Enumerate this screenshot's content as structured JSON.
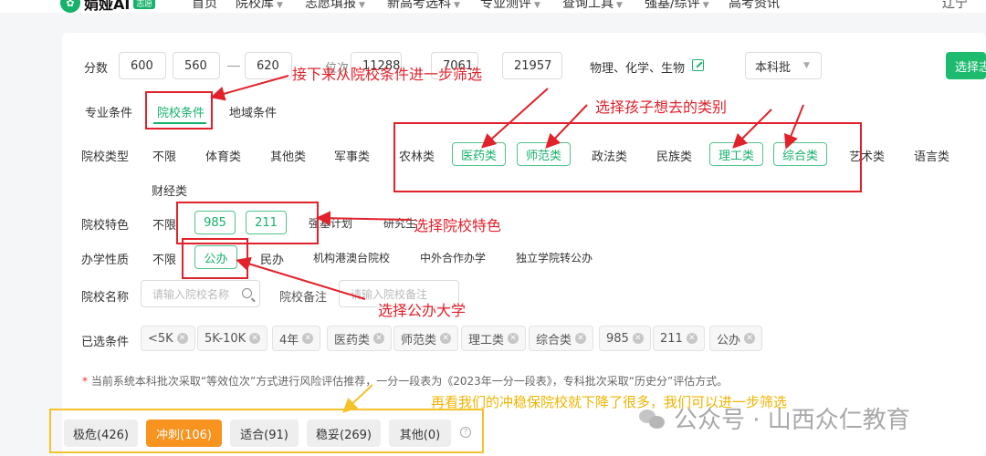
{
  "nav": {
    "logo_text": "娟娅AI",
    "logo_badge": "志愿",
    "items": [
      "首页",
      "院校库",
      "志愿填报",
      "新高考选科",
      "专业测评",
      "查询工具",
      "强基/综评",
      "高考资讯"
    ],
    "user": "辽宁"
  },
  "score_row": {
    "label": "分数",
    "score1": "600",
    "score2": "560",
    "score3": "620",
    "rank_label": "位次",
    "rank1": "11288",
    "rank2": "7061",
    "rank3": "21957",
    "subjects": "物理、化学、生物",
    "batch": "本科批",
    "submit": "选择志"
  },
  "tabs": [
    "专业条件",
    "院校条件",
    "地域条件"
  ],
  "school_type": {
    "label": "院校类型",
    "options": [
      "不限",
      "体育类",
      "其他类",
      "军事类",
      "农林类",
      "医药类",
      "师范类",
      "政法类",
      "民族类",
      "理工类",
      "综合类",
      "艺术类",
      "语言类",
      "财经类"
    ]
  },
  "school_feature": {
    "label": "院校特色",
    "options": [
      "不限",
      "985",
      "211",
      "强基计划",
      "研究生"
    ]
  },
  "school_nature": {
    "label": "办学性质",
    "options": [
      "不限",
      "公办",
      "民办",
      "机构港澳台院校",
      "中外合作办学",
      "独立学院转公办"
    ]
  },
  "school_name": {
    "label": "院校名称",
    "placeholder": "请输入院校名称",
    "remark_label": "院校备注",
    "remark_placeholder": "请输入院校备注"
  },
  "selected": {
    "label": "已选条件",
    "tags": [
      "<5K",
      "5K-10K",
      "4年",
      "医药类",
      "师范类",
      "理工类",
      "综合类",
      "985",
      "211",
      "公办"
    ]
  },
  "note": "当前系统本科批次采取“等效位次”方式进行风险评估推荐，一分一段表为《2023年一分一段表》，专科批次采取“历史分”评估方式。",
  "risk": [
    "极危(426)",
    "冲刺(106)",
    "适合(91)",
    "稳妥(269)",
    "其他(0)"
  ],
  "annotations": {
    "a1": "接下来从院校条件进一步筛选",
    "a2": "选择孩子想去的类别",
    "a3": "选择院校特色",
    "a4": "选择公办大学",
    "a5": "再看我们的冲稳保院校就下降了很多，我们可以进一步筛选"
  },
  "watermark": "公众号 · 山西众仁教育",
  "colors": {
    "accent": "#16b26a",
    "annotation": "#e2212a",
    "highlight": "#f5c22b",
    "active_risk": "#f7931e"
  }
}
